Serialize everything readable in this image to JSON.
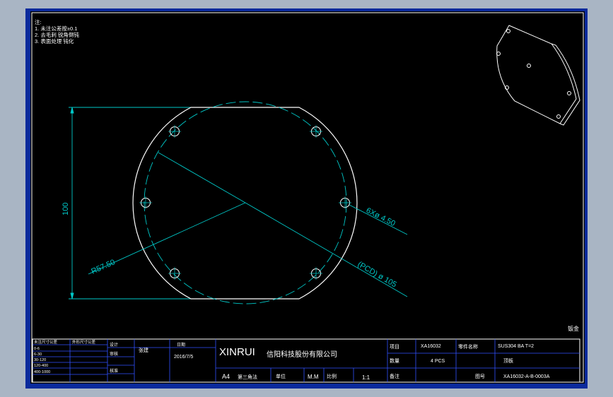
{
  "notes": {
    "lines": [
      "注:",
      "1. 未注公差按±0.1",
      "2. 去毛刺 锐角倒钝",
      "3. 表面处理 钝化"
    ]
  },
  "dimensions": {
    "height": "100",
    "radius": "R57.50",
    "holes": "6Xø 4.50",
    "pcd": "(PCD) ø 105"
  },
  "tech_mark": "钣金",
  "title_block": {
    "company_en": "XINRUI",
    "company_cn": "信阳科技股份有限公司",
    "sheet_size": "A4",
    "angle_label": "第三角法",
    "unit_label": "单位",
    "unit_value": "M.M",
    "scale_label": "比例",
    "scale_value": "1:1",
    "drawn_label": "设计",
    "drawn_by": "张建",
    "date_label": "日期",
    "date": "2016/7/5",
    "check_label": "审核",
    "approve_label": "核准",
    "project_label": "项目",
    "project": "XA16032",
    "part_label": "零件名称",
    "material": "SUS304 BA T=2",
    "qty_label": "数量",
    "qty": "4 PCS",
    "part_name": "顶板",
    "remark_label": "备注",
    "drawing_no_label": "图号",
    "drawing_no": "XA16032-A-B-0003A",
    "tol_header_left": "未注尺寸公差",
    "tol_header_right": "外形尺寸公差",
    "tol_rows": [
      "0-6",
      "6-30",
      "30-120",
      "120-400",
      "400-1000"
    ]
  }
}
